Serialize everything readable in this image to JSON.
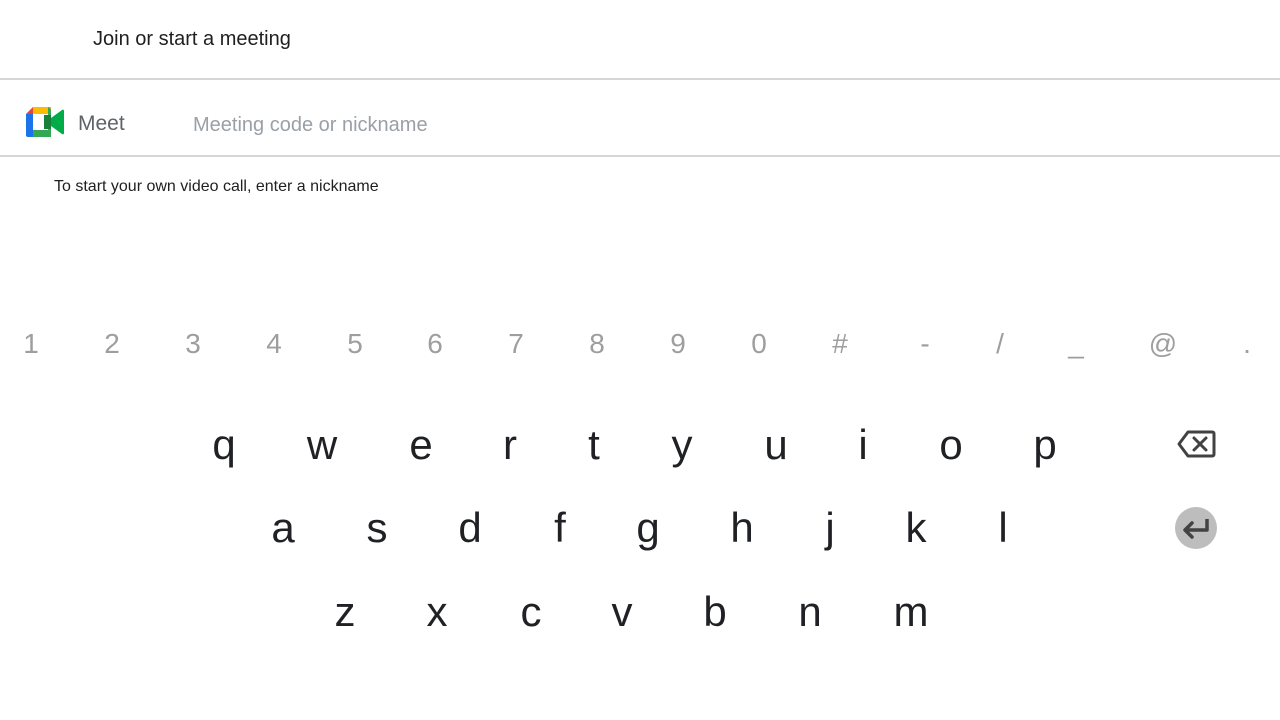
{
  "header": {
    "title": "Join or start a meeting"
  },
  "search": {
    "app_name": "Meet",
    "value": "",
    "placeholder": "Meeting code or nickname"
  },
  "hint": "To start your own video call, enter a nickname",
  "keyboard": {
    "symbols": [
      "1",
      "2",
      "3",
      "4",
      "5",
      "6",
      "7",
      "8",
      "9",
      "0",
      "#",
      "-",
      "/",
      "_",
      "@",
      "."
    ],
    "row1": [
      "q",
      "w",
      "e",
      "r",
      "t",
      "y",
      "u",
      "i",
      "o",
      "p"
    ],
    "row2": [
      "a",
      "s",
      "d",
      "f",
      "g",
      "h",
      "j",
      "k",
      "l"
    ],
    "row3": [
      "z",
      "x",
      "c",
      "v",
      "b",
      "n",
      "m"
    ],
    "backspace_icon": "backspace-icon",
    "enter_icon": "enter-icon"
  },
  "colors": {
    "symbol_key": "#9e9e9e",
    "letter_key": "#202124",
    "enter_bg": "#bdbdbd",
    "divider": "#d6d6d6"
  }
}
